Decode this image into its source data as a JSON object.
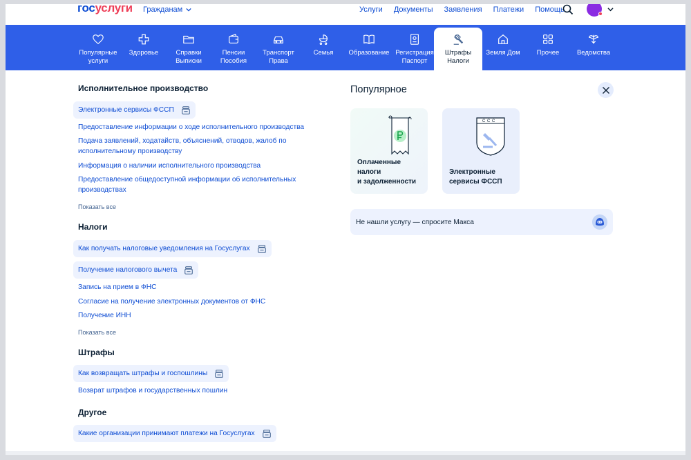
{
  "header": {
    "logo_part1": "гос",
    "logo_part2": "услуги",
    "audience": "Гражданам",
    "nav": [
      "Услуги",
      "Документы",
      "Заявления",
      "Платежи",
      "Помощь"
    ]
  },
  "categories": [
    {
      "line1": "Популярные",
      "line2": "услуги",
      "icon": "heart-icon"
    },
    {
      "line1": "Здоровье",
      "line2": "",
      "icon": "plus-icon"
    },
    {
      "line1": "Справки",
      "line2": "Выписки",
      "icon": "folder-icon"
    },
    {
      "line1": "Пенсии",
      "line2": "Пособия",
      "icon": "wallet-icon"
    },
    {
      "line1": "Транспорт",
      "line2": "Права",
      "icon": "car-icon"
    },
    {
      "line1": "Семья",
      "line2": "",
      "icon": "stroller-icon"
    },
    {
      "line1": "Образование",
      "line2": "",
      "icon": "book-icon"
    },
    {
      "line1": "Регистрация",
      "line2": "Паспорт",
      "icon": "passport-icon"
    },
    {
      "line1": "Штрафы",
      "line2": "Налоги",
      "icon": "gavel-icon",
      "active": true
    },
    {
      "line1": "Земля Дом",
      "line2": "",
      "icon": "house-icon"
    },
    {
      "line1": "Прочее",
      "line2": "",
      "icon": "grid-icon"
    },
    {
      "line1": "Ведомства",
      "line2": "",
      "icon": "emblem-icon"
    }
  ],
  "sections": {
    "enforcement": {
      "title": "Исполнительное производство",
      "pill": "Электронные сервисы ФССП",
      "links": [
        "Предоставление информации о ходе исполнительного производства",
        "Подача заявлений, ходатайств, объяснений, отводов, жалоб по",
        "исполнительному производству",
        "Информация о наличии исполнительного производства",
        "Предоставление общедоступной информации об исполнительных",
        "производствах"
      ],
      "more": "Показать все"
    },
    "taxes": {
      "title": "Налоги",
      "pill1": "Как получать налоговые уведомления на Госуслугах",
      "pill2": "Получение налогового вычета",
      "links": [
        "Запись на прием в ФНС",
        "Согласие на получение электронных документов от ФНС",
        "Получение ИНН"
      ],
      "more": "Показать все"
    },
    "fines": {
      "title": "Штрафы",
      "pill": "Как возвращать штрафы и госпошлины",
      "links": [
        "Возврат штрафов и государственных пошлин"
      ]
    },
    "other": {
      "title": "Другое",
      "pill": "Какие организации принимают платежи на Госуслугах"
    }
  },
  "popular": {
    "title": "Популярное",
    "card1": {
      "line1": "Оплаченные",
      "line2": "налоги",
      "line3": "и задолженности"
    },
    "card2": {
      "line1": "Электронные",
      "line2": "сервисы ФССП",
      "emblem_text": "С С С"
    },
    "ask": "Не нашли услугу — спросите Макса"
  },
  "colors": {
    "brand_blue": "#0d4cd3",
    "brand_red": "#ee3f58",
    "catbar": "#2f5fe8",
    "pill_bg": "#edf2fe"
  }
}
